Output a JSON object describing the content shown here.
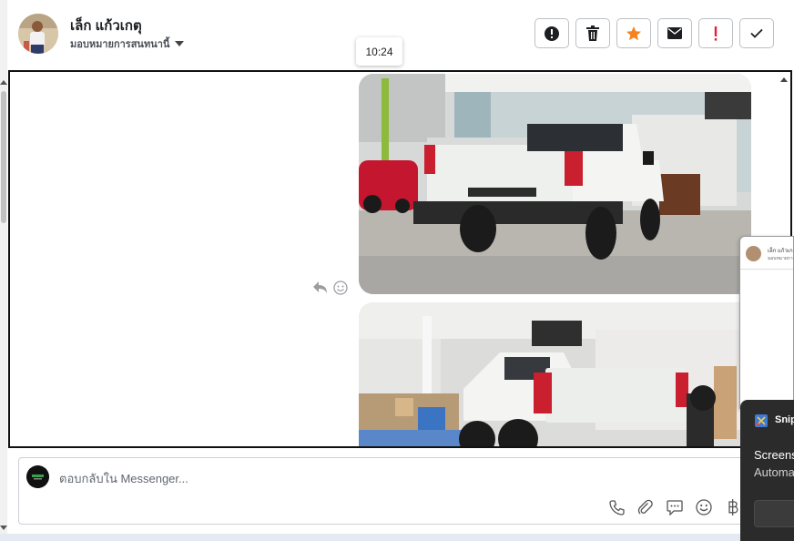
{
  "header": {
    "name": "เล็ก แก้วเกตุ",
    "assign_label": "มอบหมายการสนทนานี้",
    "actions": [
      {
        "name": "spam-button",
        "icon": "alert-circle-icon"
      },
      {
        "name": "delete-button",
        "icon": "trash-icon"
      },
      {
        "name": "star-button",
        "icon": "star-icon",
        "color": "#f5831f"
      },
      {
        "name": "mark-unread-button",
        "icon": "envelope-icon"
      },
      {
        "name": "follow-up-button",
        "icon": "exclamation-icon",
        "color": "#e41e3f"
      },
      {
        "name": "mark-done-button",
        "icon": "check-icon"
      }
    ]
  },
  "tooltip": {
    "time": "10:24"
  },
  "thread": {
    "photos": [
      {
        "subject": "white pickup truck rear view in showroom"
      },
      {
        "subject": "white Isuzu pickup truck rear view in showroom"
      }
    ],
    "message_tools": [
      "reply-icon",
      "emoji-reaction-icon"
    ]
  },
  "composer": {
    "placeholder": "ตอบกลับใน Messenger...",
    "tools": [
      "phone-icon",
      "attachment-icon",
      "saved-reply-icon",
      "emoji-icon",
      "baht-payment-icon"
    ]
  },
  "mini_window": {
    "name": "เล็ก แก้วเก",
    "sub": "มอบหมายการสน"
  },
  "snip_notification": {
    "title": "Snip",
    "line1": "Screens",
    "line2": "Automa"
  },
  "colors": {
    "accent_star": "#f5831f",
    "accent_alert": "#e41e3f",
    "border": "#bcc0c4"
  }
}
